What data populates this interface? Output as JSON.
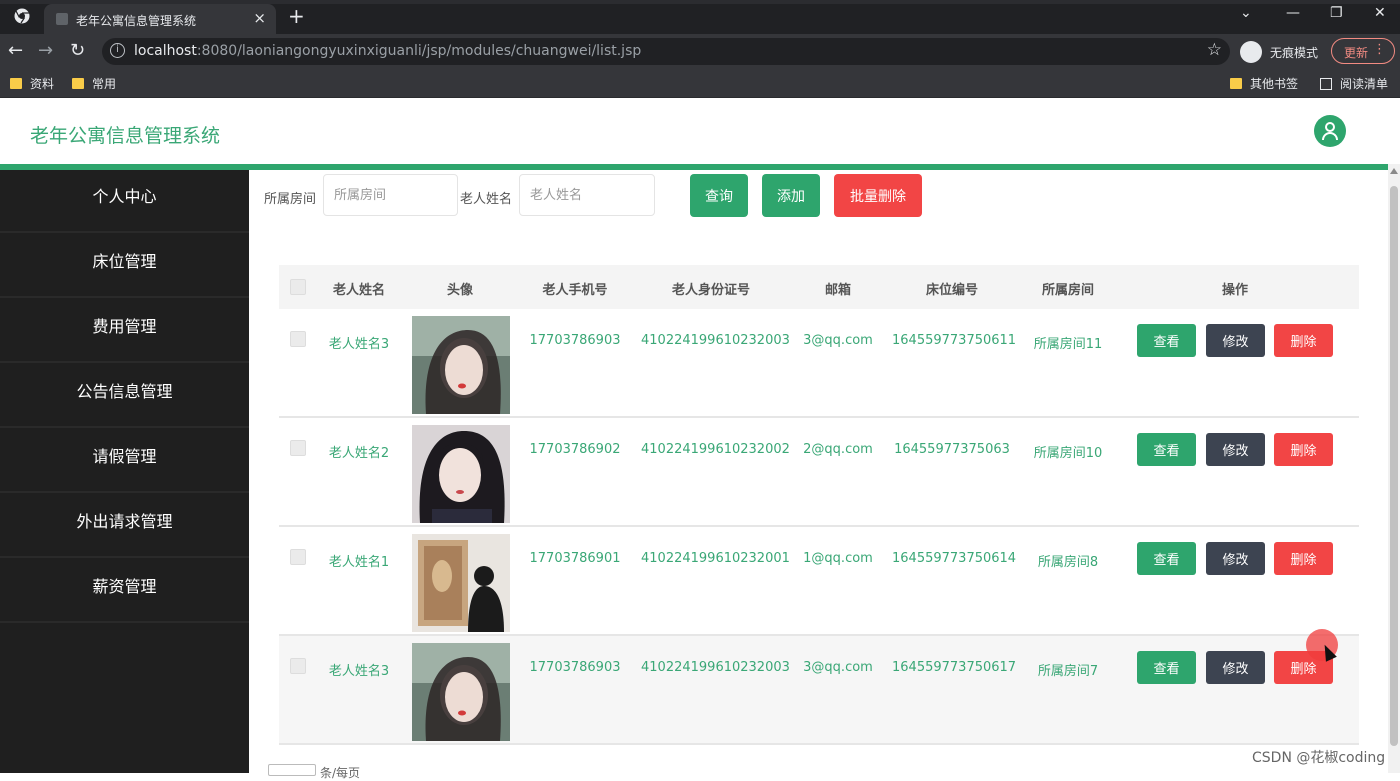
{
  "browser": {
    "tab_title": "老年公寓信息管理系统",
    "tab_close": "×",
    "new_tab": "+",
    "url_host": "localhost",
    "url_rest": ":8080/laoniangongyuxinxiguanli/jsp/modules/chuangwei/list.jsp",
    "incognito_label": "无痕模式",
    "update_label": "更新",
    "bookmarks": [
      "资料",
      "常用"
    ],
    "bookmarks_right": [
      "其他书签",
      "阅读清单"
    ]
  },
  "app": {
    "title": "老年公寓信息管理系统",
    "accent_color": "#2ea56d",
    "danger_color": "#f24545"
  },
  "sidebar": {
    "items": [
      {
        "label": "个人中心"
      },
      {
        "label": "床位管理"
      },
      {
        "label": "费用管理"
      },
      {
        "label": "公告信息管理"
      },
      {
        "label": "请假管理"
      },
      {
        "label": "外出请求管理"
      },
      {
        "label": "薪资管理"
      }
    ]
  },
  "search": {
    "room_label": "所属房间",
    "room_placeholder": "所属房间",
    "name_label": "老人姓名",
    "name_placeholder": "老人姓名",
    "query_button": "查询",
    "add_button": "添加",
    "batch_delete_button": "批量删除"
  },
  "table": {
    "headers": [
      "老人姓名",
      "头像",
      "老人手机号",
      "老人身份证号",
      "邮箱",
      "床位编号",
      "所属房间",
      "操作"
    ],
    "rows": [
      {
        "name": "老人姓名3",
        "phone": "17703786903",
        "id_card": "410224199610232003",
        "email": "3@qq.com",
        "bed_no": "164559773750611",
        "room": "所属房间11",
        "avatar": "photo-1"
      },
      {
        "name": "老人姓名2",
        "phone": "17703786902",
        "id_card": "410224199610232002",
        "email": "2@qq.com",
        "bed_no": "16455977375063",
        "room": "所属房间10",
        "avatar": "photo-2"
      },
      {
        "name": "老人姓名1",
        "phone": "17703786901",
        "id_card": "410224199610232001",
        "email": "1@qq.com",
        "bed_no": "164559773750614",
        "room": "所属房间8",
        "avatar": "photo-3"
      },
      {
        "name": "老人姓名3",
        "phone": "17703786903",
        "id_card": "410224199610232003",
        "email": "3@qq.com",
        "bed_no": "164559773750617",
        "room": "所属房间7",
        "avatar": "photo-1"
      }
    ],
    "actions": {
      "view": "查看",
      "edit": "修改",
      "delete": "删除"
    }
  },
  "pager": {
    "text": "条/每页"
  },
  "watermark": "CSDN @花椒coding"
}
